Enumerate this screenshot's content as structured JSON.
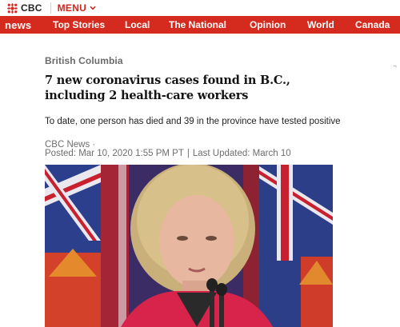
{
  "header": {
    "logo_text": "CBC",
    "menu_label": "MENU",
    "logo_icon": "cbc-gem-icon",
    "menu_icon": "chevron-down-icon"
  },
  "nav": {
    "brand": "news",
    "items": [
      {
        "label": "Top Stories"
      },
      {
        "label": "Local"
      },
      {
        "label": "The National"
      },
      {
        "label": "Opinion"
      },
      {
        "label": "World"
      },
      {
        "label": "Canada"
      }
    ]
  },
  "article": {
    "section": "British Columbia",
    "headline": "7 new coronavirus cases found in B.C., including 2 health-care workers",
    "deck": "To date, one person has died and 39 in the province have tested positive",
    "byline": "CBC News ·",
    "posted": "Posted: Mar 10, 2020 1:55 PM PT",
    "separator": "|",
    "updated": "Last Updated: March 10"
  },
  "side_mark": "¬",
  "colors": {
    "brand_red": "#d52b1e",
    "menu_red": "#d62418",
    "text_dark": "#141414",
    "text_gray": "#6e6e6e"
  }
}
